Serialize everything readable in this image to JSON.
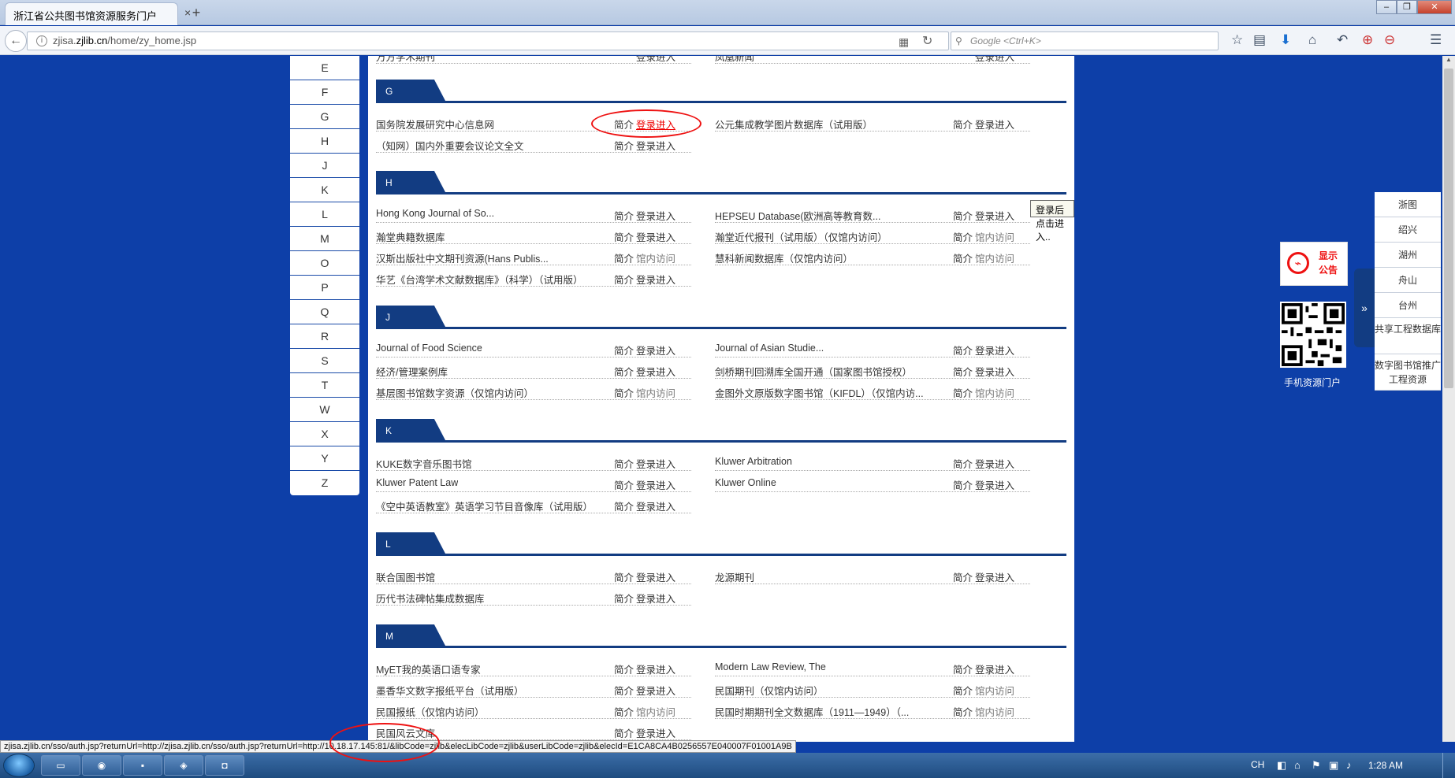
{
  "browser": {
    "tab_title": "浙江省公共图书馆资源服务门户",
    "tab_close": "×",
    "new_tab": "+",
    "url_prefix": "zjisa.",
    "url_host": "zjlib.cn",
    "url_path": "/home/zy_home.jsp",
    "search_placeholder": "Google <Ctrl+K>"
  },
  "letters": [
    "E",
    "F",
    "G",
    "H",
    "J",
    "K",
    "L",
    "M",
    "O",
    "P",
    "Q",
    "R",
    "S",
    "T",
    "W",
    "X",
    "Y",
    "Z"
  ],
  "sections": {
    "top": {
      "left": {
        "name": "万方学术期刊",
        "intro": "",
        "action": "登录进入"
      },
      "right": {
        "name": "凤凰新闻",
        "intro": "",
        "action": "登录进入"
      }
    },
    "G": {
      "label": "G",
      "rows": [
        {
          "left": {
            "name": "国务院发展研究中心信息网",
            "intro": "简介",
            "action": "登录进入"
          },
          "right": {
            "name": "公元集成教学图片数据库（试用版）",
            "intro": "简介",
            "action": "登录进入"
          }
        },
        {
          "left": {
            "name": "（知网）国内外重要会议论文全文",
            "intro": "简介",
            "action": "登录进入"
          }
        }
      ]
    },
    "H": {
      "label": "H",
      "rows": [
        {
          "left": {
            "name": "Hong Kong Journal of So...",
            "intro": "简介",
            "action": "登录进入"
          },
          "right": {
            "name": "HEPSEU Database(欧洲高等教育数...",
            "intro": "简介",
            "action": "登录进入"
          }
        },
        {
          "left": {
            "name": "瀚堂典籍数据库",
            "intro": "简介",
            "action": "登录进入"
          },
          "right": {
            "name": "瀚堂近代报刊（试用版）（仅馆内访问）",
            "intro": "简介",
            "action": "馆内访问"
          }
        },
        {
          "left": {
            "name": "汉斯出版社中文期刊资源(Hans Publis...",
            "intro": "简介",
            "action": "馆内访问"
          },
          "right": {
            "name": "慧科新闻数据库（仅馆内访问）",
            "intro": "简介",
            "action": "馆内访问"
          }
        },
        {
          "left": {
            "name": "华艺《台湾学术文献数据库》（科学）（试用版）",
            "intro": "简介",
            "action": "登录进入"
          }
        }
      ]
    },
    "J": {
      "label": "J",
      "rows": [
        {
          "left": {
            "name": "Journal of Food Science",
            "intro": "简介",
            "action": "登录进入"
          },
          "right": {
            "name": "Journal of Asian Studie...",
            "intro": "简介",
            "action": "登录进入"
          }
        },
        {
          "left": {
            "name": "经济/管理案例库",
            "intro": "简介",
            "action": "登录进入"
          },
          "right": {
            "name": "剑桥期刊回溯库全国开通（国家图书馆授权）",
            "intro": "简介",
            "action": "登录进入"
          }
        },
        {
          "left": {
            "name": "基层图书馆数字资源（仅馆内访问）",
            "intro": "简介",
            "action": "馆内访问"
          },
          "right": {
            "name": "金图外文原版数字图书馆（KIFDL）（仅馆内访...",
            "intro": "简介",
            "action": "馆内访问"
          }
        }
      ]
    },
    "K": {
      "label": "K",
      "rows": [
        {
          "left": {
            "name": "KUKE数字音乐图书馆",
            "intro": "简介",
            "action": "登录进入"
          },
          "right": {
            "name": "Kluwer Arbitration",
            "intro": "简介",
            "action": "登录进入"
          }
        },
        {
          "left": {
            "name": "Kluwer Patent Law",
            "intro": "简介",
            "action": "登录进入"
          },
          "right": {
            "name": "Kluwer Online",
            "intro": "简介",
            "action": "登录进入"
          }
        },
        {
          "left": {
            "name": "《空中英语教室》英语学习节目音像库（试用版）",
            "intro": "简介",
            "action": "登录进入"
          }
        }
      ]
    },
    "L": {
      "label": "L",
      "rows": [
        {
          "left": {
            "name": "联合国图书馆",
            "intro": "简介",
            "action": "登录进入"
          },
          "right": {
            "name": "龙源期刊",
            "intro": "简介",
            "action": "登录进入"
          }
        },
        {
          "left": {
            "name": "历代书法碑帖集成数据库",
            "intro": "简介",
            "action": "登录进入"
          }
        }
      ]
    },
    "M": {
      "label": "M",
      "rows": [
        {
          "left": {
            "name": "MyET我的英语口语专家",
            "intro": "简介",
            "action": "登录进入"
          },
          "right": {
            "name": "Modern Law Review, The",
            "intro": "简介",
            "action": "登录进入"
          }
        },
        {
          "left": {
            "name": "墨香华文数字报纸平台（试用版）",
            "intro": "简介",
            "action": "登录进入"
          },
          "right": {
            "name": "民国期刊（仅馆内访问）",
            "intro": "简介",
            "action": "馆内访问"
          }
        },
        {
          "left": {
            "name": "民国报纸（仅馆内访问）",
            "intro": "简介",
            "action": "馆内访问"
          },
          "right": {
            "name": "民国时期期刊全文数据库（1911—1949）（...",
            "intro": "简介",
            "action": "馆内访问"
          }
        },
        {
          "left": {
            "name": "民国风云文库",
            "intro": "简介",
            "action": "登录进入"
          }
        }
      ]
    }
  },
  "tooltip": "登录后点击进入..",
  "notice": {
    "line1": "显示",
    "line2": "公告"
  },
  "qr_label": "手机资源门户",
  "side_nav": [
    "浙图",
    "绍兴",
    "湖州",
    "舟山",
    "台州",
    "共享工程数据库",
    "数字图书馆推广工程资源"
  ],
  "status_url": "zjisa.zjlib.cn/sso/auth.jsp?returnUrl=http://zjisa.zjlib.cn/sso/auth.jsp?returnUrl=http://10.18.17.145:81/&libCode=zjlib&elecLibCode=zjlib&userLibCode=zjlib&elecId=E1CA8CA4B0256557E040007F01001A9B",
  "taskbar": {
    "lang": "CH",
    "clock": "1:28 AM"
  },
  "colors": {
    "page_bg": "#0d3fa8",
    "section_navy": "#123c82",
    "annotation_red": "#e11"
  }
}
